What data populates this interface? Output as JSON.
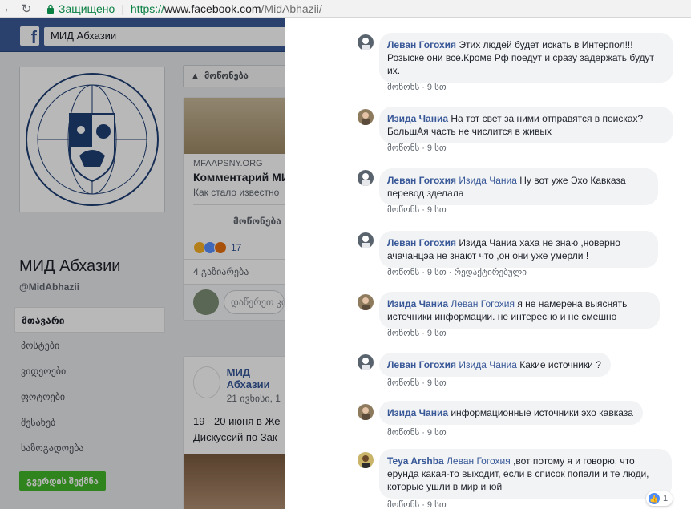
{
  "browser": {
    "back_icon": "arrow-left-icon",
    "refresh_icon": "refresh-icon",
    "secure_label": "Защищено",
    "url_scheme": "https://",
    "url_host": "www.facebook.com",
    "url_path": "/MidAbhazii/"
  },
  "fb": {
    "search_value": "МИД Абхазии",
    "page_name": "МИД Абхазии",
    "page_handle": "@MidAbhazii",
    "nav": [
      "მთავარი",
      "პოსტები",
      "ვიდეოები",
      "ფოტოები",
      "შესახებ",
      "საზოგადოება"
    ],
    "create_page": "გვერდის შექმნა",
    "like_button": "მოწონება",
    "link_domain": "MFAAPSNY.ORG",
    "link_title": "Комментарий МИД",
    "link_desc": "Как стало известно",
    "link_like": "მოწონება",
    "reactions_count": "17",
    "shares": "4 გაზიარება",
    "comment_placeholder": "დაწერეთ კომენტარი...",
    "post2_name": "МИД Абхазии",
    "post2_date": "21 ივნისი, 1",
    "post2_line1": "19 - 20 июня в Же",
    "post2_line2": "Дискуссий по Зак"
  },
  "comments": [
    {
      "author": "Леван Гогохия",
      "mention": "",
      "text": "Этих людей будет искать в Интерпол!!! Розыске они все.Кроме Рф поедут и сразу задержать будут их.",
      "like": "მოწონს",
      "time": "9 სთ",
      "extra": ""
    },
    {
      "author": "Изида Чаниа",
      "mention": "",
      "text": "На тот свет за ними отправятся в поисках? БольшАя часть не числится в живых",
      "like": "მოწონს",
      "time": "9 სთ",
      "extra": ""
    },
    {
      "author": "Леван Гогохия",
      "mention": "Изида Чаниа",
      "text": "Ну вот уже Эхо Кавказа перевод зделала",
      "like": "მოწონს",
      "time": "9 სთ",
      "extra": ""
    },
    {
      "author": "Леван Гогохия",
      "mention": "",
      "text": "Изида Чаниа хаха не знаю ,новерно ачачанцэа не знают что ,он они уже умерли !",
      "like": "მოწონს",
      "time": "9 სთ",
      "extra": "რედაქტირებული"
    },
    {
      "author": "Изида Чаниа",
      "mention": "Леван Гогохия",
      "text": "я не намерена выяснять источники информации. не интересно и не смешно",
      "like": "მოწონს",
      "time": "9 სთ",
      "extra": ""
    },
    {
      "author": "Леван Гогохия",
      "mention": "Изида Чаниа",
      "text": "Какие источники ?",
      "like": "მოწონს",
      "time": "9 სთ",
      "extra": ""
    },
    {
      "author": "Изида Чаниа",
      "mention": "",
      "text": "информационные источники эхо кавказа",
      "like": "მოწონს",
      "time": "9 სთ",
      "extra": ""
    },
    {
      "author": "Teya Arshba",
      "mention": "Леван Гогохия",
      "text": ",вот потому я и говорю, что ерунда какая-то выходит, если в список попали и те люди, которые ушли в мир иной",
      "like": "მოწონს",
      "time": "9 სთ",
      "extra": ""
    }
  ],
  "last_comment_likes": "1"
}
